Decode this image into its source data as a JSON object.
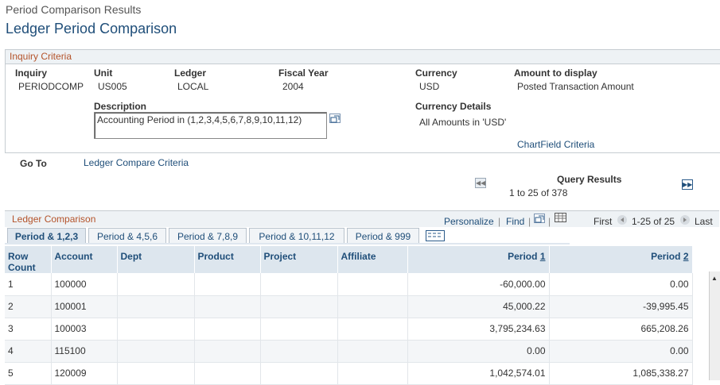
{
  "breadcrumb": "Period Comparison Results",
  "page_title": "Ledger Period Comparison",
  "inquiry": {
    "section_title": "Inquiry Criteria",
    "labels": {
      "inquiry": "Inquiry",
      "unit": "Unit",
      "ledger": "Ledger",
      "fiscal_year": "Fiscal Year",
      "currency": "Currency",
      "amount_to_display": "Amount to display",
      "description": "Description",
      "currency_details": "Currency Details"
    },
    "values": {
      "inquiry": "PERIODCOMP",
      "unit": "US005",
      "ledger": "LOCAL",
      "fiscal_year": "2004",
      "currency": "USD",
      "amount_to_display": "Posted Transaction Amount",
      "description": "Accounting Period in   (1,2,3,4,5,6,7,8,9,10,11,12)",
      "currency_details": "All Amounts in 'USD'"
    },
    "chartfield_link": "ChartField Criteria"
  },
  "goto": {
    "label": "Go To",
    "link": "Ledger Compare Criteria"
  },
  "query_results": {
    "title": "Query Results",
    "range": "1 to 25 of 378"
  },
  "grid": {
    "title": "Ledger Comparison",
    "personalize": "Personalize",
    "find": "Find",
    "first": "First",
    "range": "1-25 of 25",
    "last": "Last",
    "tabs": [
      "Period & 1,2,3",
      "Period & 4,5,6",
      "Period & 7,8,9",
      "Period & 10,11,12",
      "Period & 999"
    ],
    "columns": {
      "row_count_1": "Row",
      "row_count_2": "Count",
      "account": "Account",
      "dept": "Dept",
      "product": "Product",
      "project": "Project",
      "affiliate": "Affiliate",
      "period1_prefix": "Period ",
      "period1_num": "1",
      "period2_prefix": "Period ",
      "period2_num": "2"
    },
    "rows": [
      {
        "count": "1",
        "account": "100000",
        "dept": "",
        "product": "",
        "project": "",
        "affiliate": "",
        "p1": "-60,000.00",
        "p2": "0.00"
      },
      {
        "count": "2",
        "account": "100001",
        "dept": "",
        "product": "",
        "project": "",
        "affiliate": "",
        "p1": "45,000.22",
        "p2": "-39,995.45"
      },
      {
        "count": "3",
        "account": "100003",
        "dept": "",
        "product": "",
        "project": "",
        "affiliate": "",
        "p1": "3,795,234.63",
        "p2": "665,208.26"
      },
      {
        "count": "4",
        "account": "115100",
        "dept": "",
        "product": "",
        "project": "",
        "affiliate": "",
        "p1": "0.00",
        "p2": "0.00"
      },
      {
        "count": "5",
        "account": "120009",
        "dept": "",
        "product": "",
        "project": "",
        "affiliate": "",
        "p1": "1,042,574.01",
        "p2": "1,085,338.27"
      }
    ]
  }
}
